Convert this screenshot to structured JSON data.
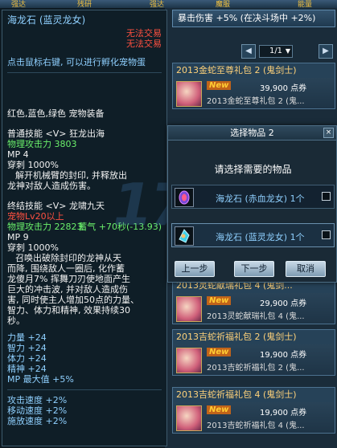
{
  "topbar": {
    "items": [
      "强达",
      "残研",
      "强达",
      "魔服",
      "能量"
    ]
  },
  "shop": {
    "crit_bar": "暴击伤害 +5% (在决斗场中 +2%)",
    "pager": {
      "value": "1/1"
    },
    "items": [
      {
        "title": "2013金蛇至尊礼包 2 (鬼剑士)",
        "badge": "New",
        "price": "39,900 点券",
        "name": "2013金蛇至尊礼包 2 (鬼..."
      },
      {
        "title": "2013灵蛇献瑞礼包 4 (鬼剑...",
        "badge": "New",
        "price": "29,900 点券",
        "name": "2013灵蛇献瑞礼包 4 (鬼..."
      },
      {
        "title": "2013吉蛇祈福礼包 2 (鬼剑士)",
        "badge": "New",
        "price": "19,900 点券",
        "name": "2013吉蛇祈福礼包 2 (鬼..."
      },
      {
        "title": "2013吉蛇祈福礼包 4 (鬼剑士)",
        "badge": "New",
        "price": "19,900 点券",
        "name": "2013吉蛇祈福礼包 4 (鬼..."
      }
    ]
  },
  "tooltip": {
    "title": "海龙石 (蓝灵龙女)",
    "trade1": "无法交易",
    "trade2": "无法交易",
    "hint": "点击鼠标右键, 可以进行孵化宠物蛋",
    "equip_line": "红色,蓝色,绿色 宠物装备",
    "skill1": {
      "header": "普通技能 <V> 狂龙出海",
      "atk_label": "物理攻击力 3803",
      "mp": "MP 4",
      "pierce": "穿刺 1000%",
      "desc1": "解开机械臂的封印, 并释放出",
      "desc2": "龙神对敌人造成伤害。"
    },
    "skill2": {
      "header": "终结技能 <V> 龙啸九天",
      "req": "宠物Lv20以上",
      "atk_label": "物理攻击力 22823",
      "charge": "蓄气 +70秒(-13.93)",
      "mp": "MP 9",
      "pierce": "穿刺 1000%",
      "desc": [
        "召唤出破除封印的龙神从天",
        "而降, 围绕敌人一圈后, 化作蓄",
        "龙傻月7% 挥舞刀刃使地面产生",
        "巨大的冲击波, 并对敌人造成伤",
        "害, 同时使主人增加50点的力量、",
        "智力、体力和精神, 效果持续30",
        "秒。"
      ]
    },
    "stats": [
      "力量 +24",
      "智力 +24",
      "体力 +24",
      "精神 +24",
      "MP 最大值 +5%"
    ],
    "speeds": [
      "攻击速度 +2%",
      "移动速度 +2%",
      "施放速度 +2%"
    ]
  },
  "watermark": "17173",
  "dialog": {
    "title": "选择物品 2",
    "close": "×",
    "prompt": "请选择需要的物品",
    "options": [
      {
        "label": "海龙石 (赤血龙女)  1个",
        "icon": "red-dragon-stone-icon"
      },
      {
        "label": "海龙石 (蓝灵龙女)  1个",
        "icon": "blue-dragon-stone-icon"
      }
    ],
    "buttons": {
      "prev": "上一步",
      "next": "下一步",
      "cancel": "取消"
    }
  },
  "colors": {
    "title_blue": "#8fd0ff",
    "red": "#ff5040",
    "green": "#6bf06b",
    "yellow": "#ffd33a",
    "panel": "#101e28"
  }
}
